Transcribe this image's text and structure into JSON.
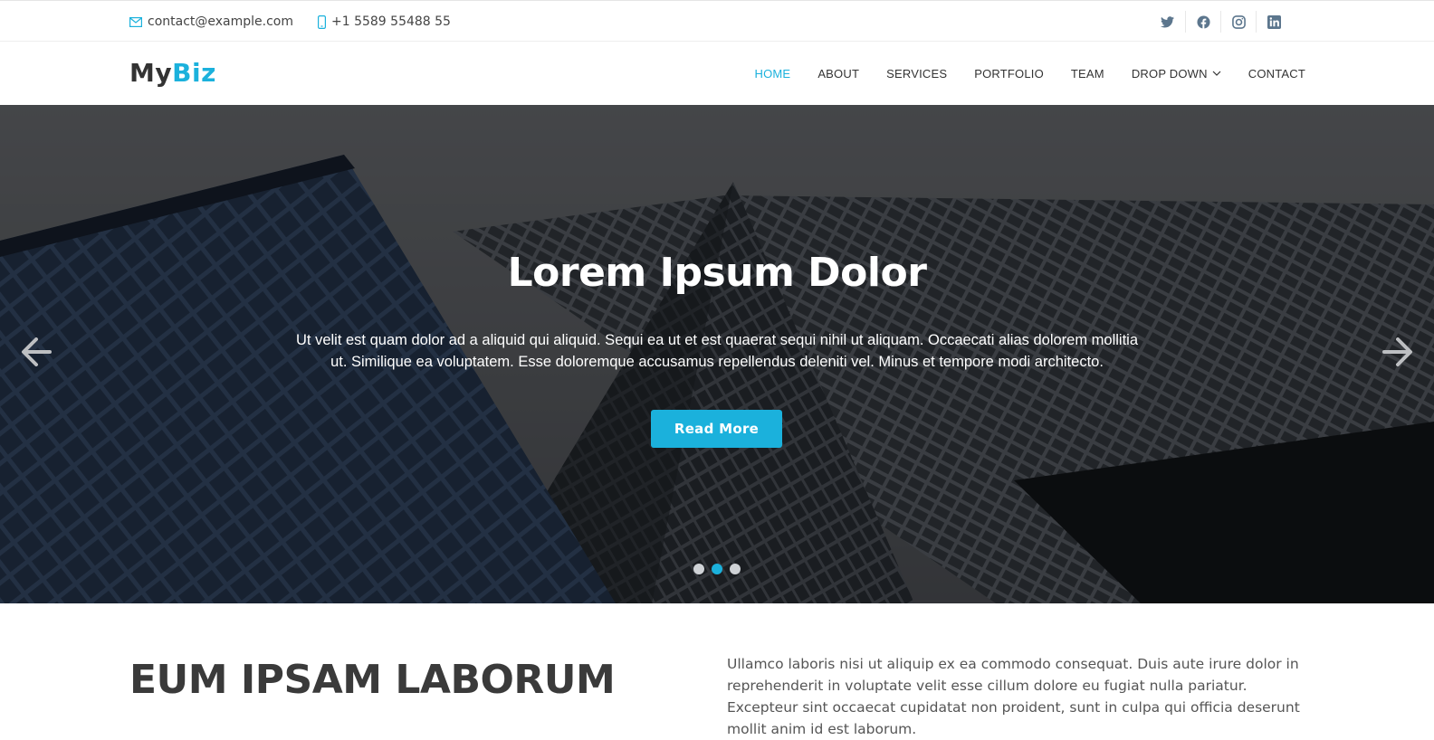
{
  "topbar": {
    "email": "contact@example.com",
    "phone": "+1 5589 55488 55",
    "social": [
      "twitter-icon",
      "facebook-icon",
      "instagram-icon",
      "linkedin-icon"
    ]
  },
  "header": {
    "logo_prefix": "My",
    "logo_accent": "Biz",
    "nav": {
      "home": "HOME",
      "about": "ABOUT",
      "services": "SERVICES",
      "portfolio": "PORTFOLIO",
      "team": "TEAM",
      "dropdown": "DROP DOWN",
      "contact": "CONTACT"
    },
    "active_nav": "HOME"
  },
  "hero": {
    "title": "Lorem Ipsum Dolor",
    "text": "Ut velit est quam dolor ad a aliquid qui aliquid. Sequi ea ut et est quaerat sequi nihil ut aliquam. Occaecati alias dolorem mollitia ut. Similique ea voluptatem. Esse doloremque accusamus repellendus deleniti vel. Minus et tempore modi architecto.",
    "button": "Read More",
    "slides": 3,
    "active_slide": 2
  },
  "about": {
    "title": "EUM IPSAM LABORUM",
    "text": "Ullamco laboris nisi ut aliquip ex ea commodo consequat. Duis aute irure dolor in reprehenderit in voluptate velit esse cillum dolore eu fugiat nulla pariatur. Excepteur sint occaecat cupidatat non proident, sunt in culpa qui officia deserunt mollit anim id est laborum."
  },
  "colors": {
    "accent": "#1bb1dc",
    "text_dark": "#333333",
    "social_icon": "#5c768d"
  }
}
